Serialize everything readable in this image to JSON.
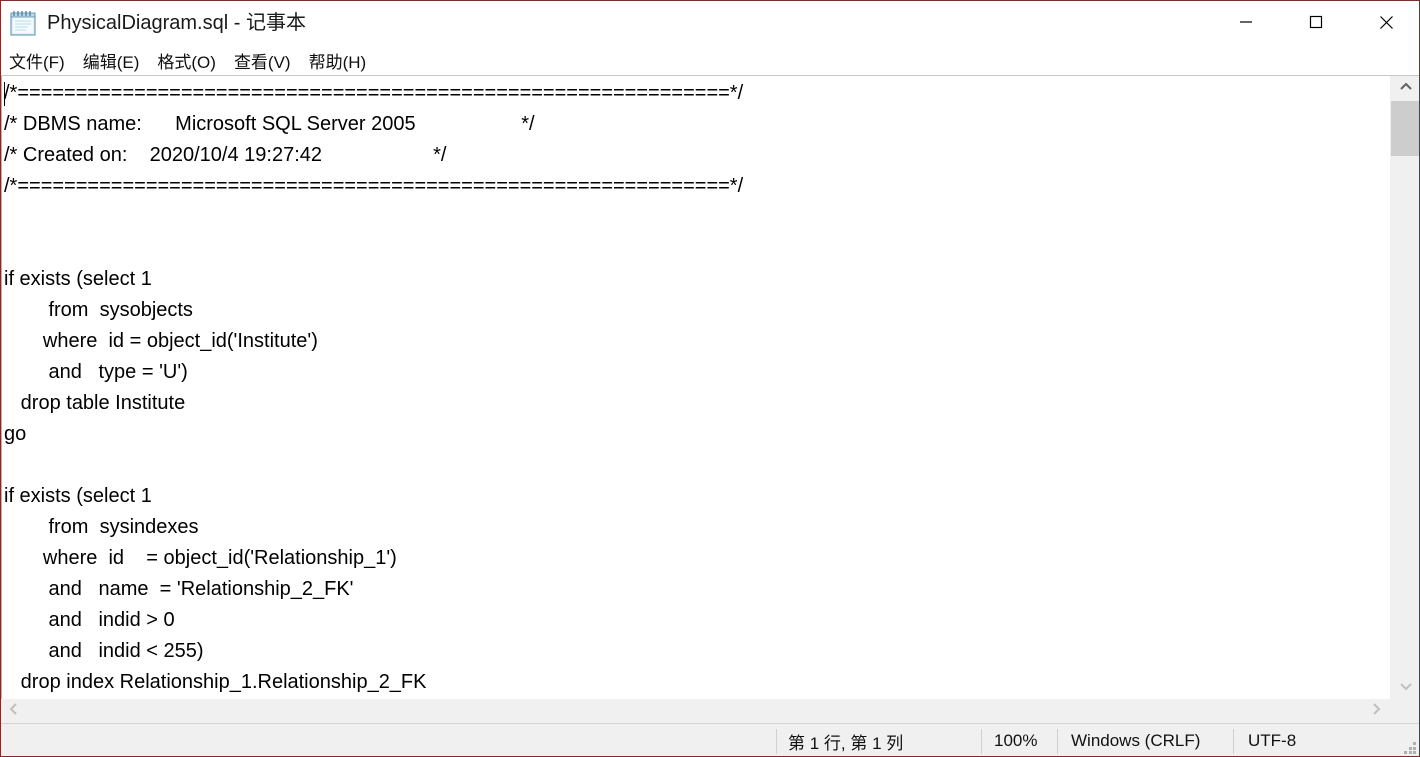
{
  "window": {
    "title": "PhysicalDiagram.sql - 记事本",
    "icon": "notepad-icon",
    "controls": {
      "minimize": "minimize-icon",
      "maximize": "maximize-icon",
      "close": "close-icon"
    }
  },
  "menubar": {
    "items": [
      {
        "label": "文件(F)"
      },
      {
        "label": "编辑(E)"
      },
      {
        "label": "格式(O)"
      },
      {
        "label": "查看(V)"
      },
      {
        "label": "帮助(H)"
      }
    ]
  },
  "editor": {
    "content": "/*=============================================================*/\n/* DBMS name:      Microsoft SQL Server 2005                   */\n/* Created on:    2020/10/4 19:27:42                    */\n/*=============================================================*/\n\n\nif exists (select 1\n        from  sysobjects\n       where  id = object_id('Institute')\n        and   type = 'U')\n   drop table Institute\ngo\n\nif exists (select 1\n        from  sysindexes\n       where  id    = object_id('Relationship_1')\n        and   name  = 'Relationship_2_FK'\n        and   indid > 0\n        and   indid < 255)\n   drop index Relationship_1.Relationship_2_FK"
  },
  "scrollbars": {
    "vertical": {
      "up_arrow": "chevron-up-icon",
      "down_arrow": "chevron-down-icon"
    },
    "horizontal": {
      "left_arrow": "chevron-left-icon",
      "right_arrow": "chevron-right-icon"
    }
  },
  "statusbar": {
    "position": "第 1 行, 第 1 列",
    "zoom": "100%",
    "line_ending": "Windows (CRLF)",
    "encoding": "UTF-8"
  }
}
